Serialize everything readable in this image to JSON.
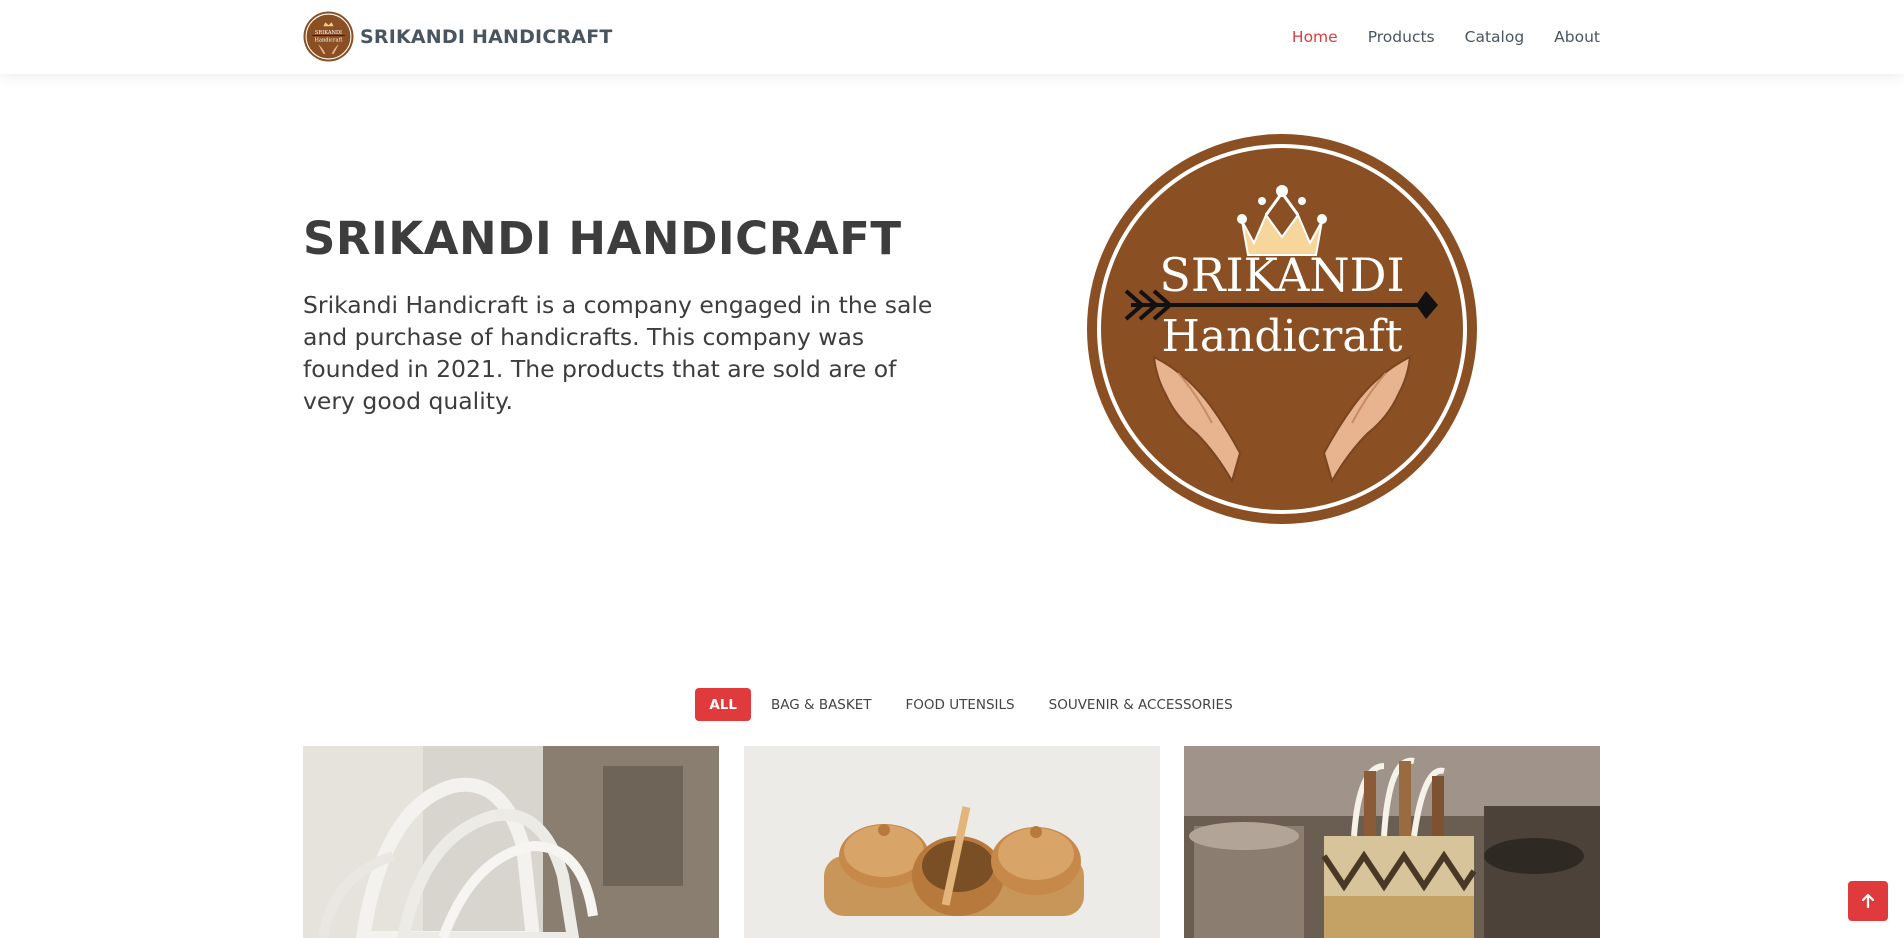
{
  "header": {
    "brand_name": "SRIKANDI HANDICRAFT",
    "nav": [
      {
        "label": "Home",
        "active": true
      },
      {
        "label": "Products",
        "active": false
      },
      {
        "label": "Catalog",
        "active": false
      },
      {
        "label": "About",
        "active": false
      }
    ]
  },
  "hero": {
    "title": "SRIKANDI HANDICRAFT",
    "description": "Srikandi Handicraft is a company engaged in the sale and purchase of handicrafts. This company was founded in 2021. The products that are sold are of very good quality.",
    "logo": {
      "line1": "SRIKANDI",
      "line2": "Handicraft"
    }
  },
  "filters": [
    {
      "label": "ALL",
      "active": true
    },
    {
      "label": "BAG & BASKET",
      "active": false
    },
    {
      "label": "FOOD UTENSILS",
      "active": false
    },
    {
      "label": "SOUVENIR & ACCESSORIES",
      "active": false
    }
  ],
  "products": [
    {
      "image": "white-woven-bags-photo"
    },
    {
      "image": "wooden-jars-photo"
    },
    {
      "image": "woven-basket-photo"
    }
  ],
  "colors": {
    "accent": "#e03a3c",
    "logo_brown": "#8a4f22",
    "text_dark": "#3d3d3d"
  },
  "icons": {
    "back_to_top": "arrow-up-icon"
  }
}
